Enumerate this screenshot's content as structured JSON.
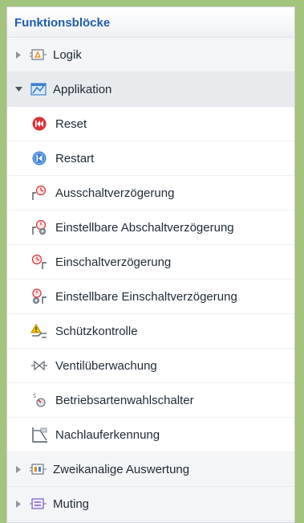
{
  "panel": {
    "title": "Funktionsblöcke"
  },
  "groups": [
    {
      "label": "Logik",
      "icon": "logic-icon",
      "expanded": false
    },
    {
      "label": "Applikation",
      "icon": "application-icon",
      "expanded": true
    },
    {
      "label": "Zweikanalige Auswertung",
      "icon": "two-channel-icon",
      "expanded": false
    },
    {
      "label": "Muting",
      "icon": "muting-icon",
      "expanded": false
    }
  ],
  "application_items": [
    {
      "label": "Reset",
      "icon": "reset-icon"
    },
    {
      "label": "Restart",
      "icon": "restart-icon"
    },
    {
      "label": "Ausschaltverzögerung",
      "icon": "off-delay-icon"
    },
    {
      "label": "Einstellbare Abschaltverzögerung",
      "icon": "adjustable-off-delay-icon"
    },
    {
      "label": "Einschaltverzögerung",
      "icon": "on-delay-icon"
    },
    {
      "label": "Einstellbare Einschaltverzögerung",
      "icon": "adjustable-on-delay-icon"
    },
    {
      "label": "Schützkontrolle",
      "icon": "contactor-control-icon"
    },
    {
      "label": "Ventilüberwachung",
      "icon": "valve-monitoring-icon"
    },
    {
      "label": "Betriebsartenwahlschalter",
      "icon": "mode-selector-icon"
    },
    {
      "label": "Nachlauferkennung",
      "icon": "overrun-detection-icon"
    }
  ],
  "colors": {
    "background": "#a3c47d",
    "title": "#1f5ea8",
    "reset_red": "#d9323a",
    "restart_blue": "#3d7fd3"
  }
}
